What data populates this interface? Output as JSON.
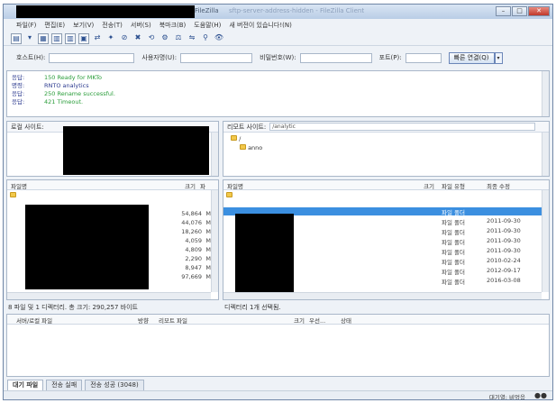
{
  "window": {
    "title_suffix": "FileZilla",
    "title_blurred": "sftp-server-address-hidden - FileZilla Client",
    "controls": {
      "minimize": "–",
      "maximize": "□",
      "close": "✕"
    }
  },
  "menu": [
    "파일(F)",
    "편집(E)",
    "보기(V)",
    "전송(T)",
    "서버(S)",
    "북마크(B)",
    "도움말(H)",
    "새 버전이 있습니다!(N)"
  ],
  "toolbar": {
    "icons": [
      "site-manager",
      "dropdown",
      "message-log",
      "local-tree",
      "remote-tree",
      "transfer-queue",
      "refresh",
      "process-queue",
      "cancel",
      "disconnect",
      "reconnect",
      "filter",
      "compare",
      "sync-browse",
      "search",
      "binoculars"
    ],
    "glyphs": [
      "▤",
      "▾",
      "▦",
      "▥",
      "▥",
      "▣",
      "⇄",
      "✦",
      "⊘",
      "✖",
      "⟲",
      "⚙",
      "⚖",
      "⇋",
      "⚲",
      "👁"
    ]
  },
  "quickconnect": {
    "host_label": "호스트(H):",
    "user_label": "사용자명(U):",
    "pass_label": "비밀번호(W):",
    "port_label": "포트(P):",
    "connect_label": "빠른 연결(Q)",
    "dropdown_glyph": "▾"
  },
  "log": [
    {
      "kind": "응답:",
      "msg": "150 Ready for MKTo",
      "type": "ok"
    },
    {
      "kind": "명령:",
      "msg": "RNTO analytics",
      "type": "cmd"
    },
    {
      "kind": "응답:",
      "msg": "250 Rename successful.",
      "type": "ok"
    },
    {
      "kind": "응답:",
      "msg": "421 Timeout.",
      "type": "ok"
    }
  ],
  "local": {
    "site_label": "로컬 사이트:",
    "columns": {
      "name": "파일명",
      "size": "크기",
      "type": "파"
    },
    "sizes": [
      "54,864",
      "44,076",
      "18,260",
      "4,059",
      "4,809",
      "2,290",
      "8,947",
      "97,669"
    ],
    "type_stub": "M",
    "status": "8 파일 및 1 디렉터리. 총 크기: 290,257 바이트"
  },
  "remote": {
    "site_label": "리모트 사이트:",
    "path": "/analytic",
    "tree": [
      "/",
      "anno"
    ],
    "columns": {
      "name": "파일명",
      "size": "크기",
      "type": "파일 유형",
      "modified": "최종 수정"
    },
    "rows": [
      {
        "type": "파일 폴더",
        "date": ""
      },
      {
        "type": "파일 폴더",
        "date": "2011-09-30"
      },
      {
        "type": "파일 폴더",
        "date": "2011-09-30"
      },
      {
        "type": "파일 폴더",
        "date": "2011-09-30"
      },
      {
        "type": "파일 폴더",
        "date": "2011-09-30"
      },
      {
        "type": "파일 폴더",
        "date": "2010-02-24"
      },
      {
        "type": "파일 폴더",
        "date": "2012-09-17"
      },
      {
        "type": "파일 폴더",
        "date": "2016-03-08"
      }
    ],
    "status": "디렉터리 1개 선택됨."
  },
  "queue": {
    "columns": {
      "server": "서버/로컬 파일",
      "direction": "방향",
      "remote": "리모트 파일",
      "size": "크기",
      "priority": "우선...",
      "status": "상태"
    }
  },
  "tabs": [
    "대기 파일",
    "전송 실패",
    "전송 성공 (3048)"
  ],
  "statusbar": {
    "queue": "대기열: 비었음",
    "dots": "●●"
  },
  "colors": {
    "accent": "#3b8fe0",
    "log_ok": "#2a9d3a",
    "log_cmd": "#2b3a8f"
  }
}
